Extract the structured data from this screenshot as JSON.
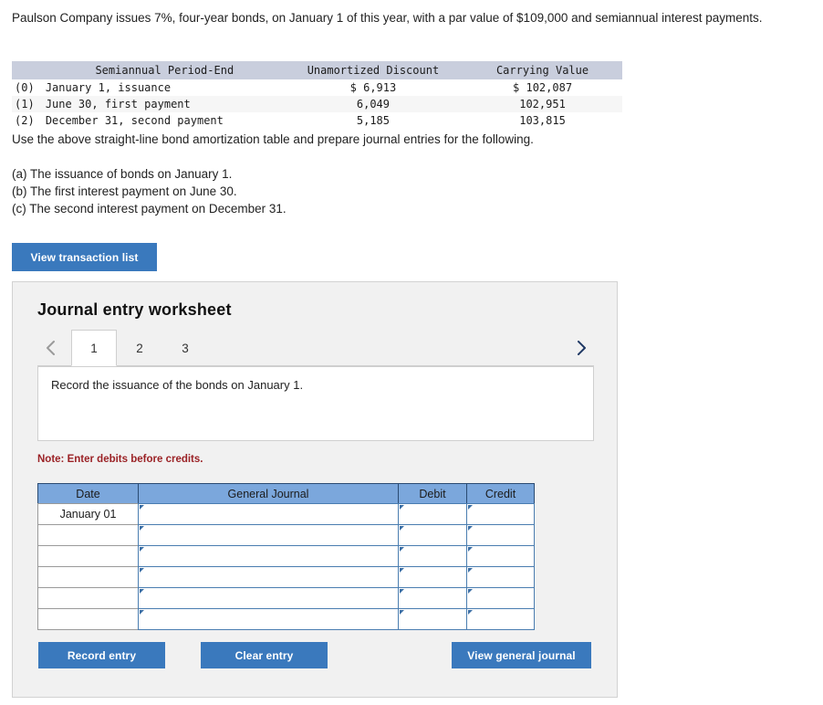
{
  "problem": {
    "statement": "Paulson Company issues 7%, four-year bonds, on January 1 of this year, with a par value of $109,000 and semiannual interest payments."
  },
  "amortization_table": {
    "headers": {
      "index": "",
      "period_end": "Semiannual Period-End",
      "unamortized_discount": "Unamortized Discount",
      "carrying_value": "Carrying Value"
    },
    "rows": [
      {
        "index": "(0)",
        "period_end": "January 1, issuance",
        "unamortized_discount": "$ 6,913",
        "carrying_value": "$ 102,087"
      },
      {
        "index": "(1)",
        "period_end": "June 30, first payment",
        "unamortized_discount": "6,049",
        "carrying_value": "102,951"
      },
      {
        "index": "(2)",
        "period_end": "December 31, second payment",
        "unamortized_discount": "5,185",
        "carrying_value": "103,815"
      }
    ]
  },
  "instructions": {
    "use_line": "Use the above straight-line bond amortization table and prepare journal entries for the following.",
    "items": [
      "(a) The issuance of bonds on January 1.",
      "(b) The first interest payment on June 30.",
      "(c) The second interest payment on December 31."
    ]
  },
  "buttons": {
    "view_transaction_list": "View transaction list",
    "record_entry": "Record entry",
    "clear_entry": "Clear entry",
    "view_general_journal": "View general journal"
  },
  "worksheet": {
    "title": "Journal entry worksheet",
    "nav": {
      "prev_icon": "chevron-left-icon",
      "next_icon": "chevron-right-icon"
    },
    "tabs": [
      {
        "label": "1",
        "active": true
      },
      {
        "label": "2",
        "active": false
      },
      {
        "label": "3",
        "active": false
      }
    ],
    "instruction": "Record the issuance of the bonds on January 1.",
    "note": "Note: Enter debits before credits.",
    "journal": {
      "columns": [
        "Date",
        "General Journal",
        "Debit",
        "Credit"
      ],
      "rows": [
        {
          "date": "January 01",
          "general_journal": "",
          "debit": "",
          "credit": ""
        },
        {
          "date": "",
          "general_journal": "",
          "debit": "",
          "credit": ""
        },
        {
          "date": "",
          "general_journal": "",
          "debit": "",
          "credit": ""
        },
        {
          "date": "",
          "general_journal": "",
          "debit": "",
          "credit": ""
        },
        {
          "date": "",
          "general_journal": "",
          "debit": "",
          "credit": ""
        },
        {
          "date": "",
          "general_journal": "",
          "debit": "",
          "credit": ""
        }
      ]
    }
  },
  "colors": {
    "button_blue": "#3a79bd",
    "table_header_blue": "#7ba7dc",
    "amort_header": "#c9cedd",
    "note_red": "#9b2226"
  }
}
